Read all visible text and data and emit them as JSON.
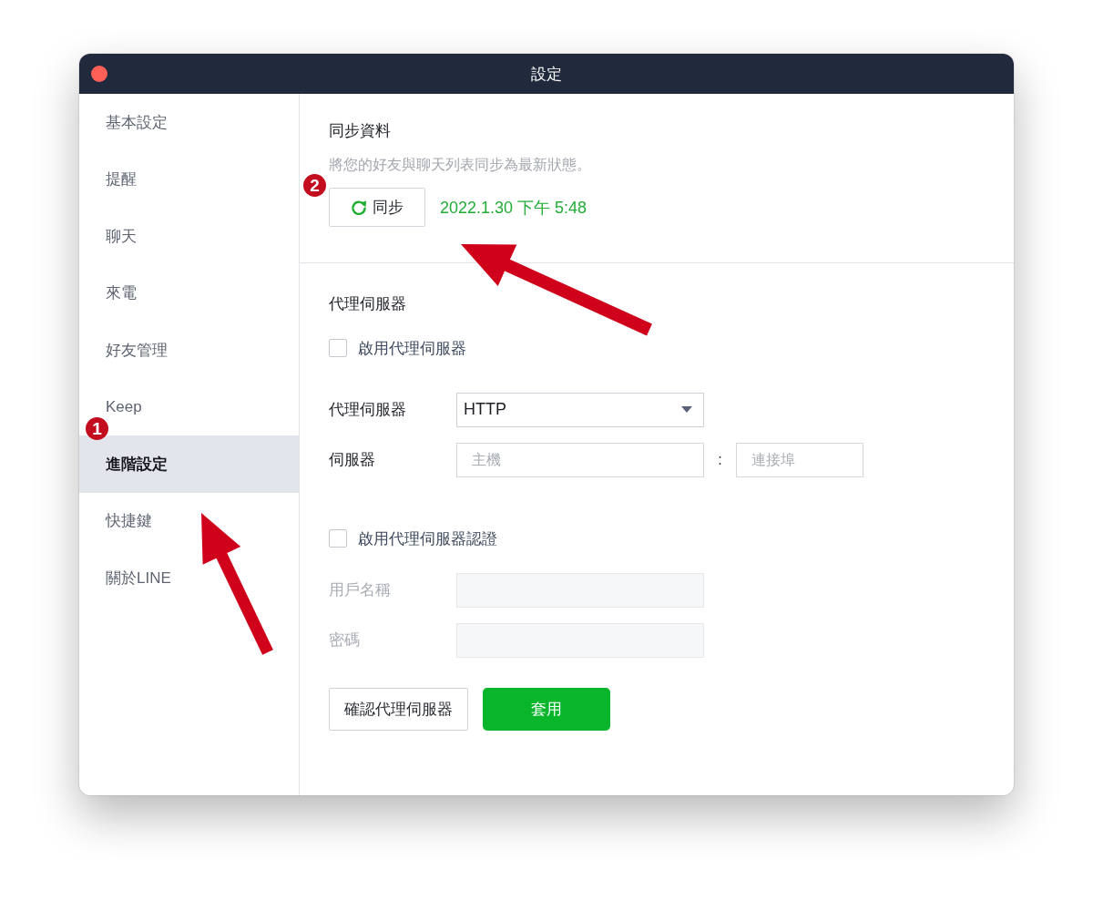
{
  "window": {
    "title": "設定"
  },
  "sidebar": {
    "items": [
      {
        "label": "基本設定",
        "selected": false
      },
      {
        "label": "提醒",
        "selected": false
      },
      {
        "label": "聊天",
        "selected": false
      },
      {
        "label": "來電",
        "selected": false
      },
      {
        "label": "好友管理",
        "selected": false
      },
      {
        "label": "Keep",
        "selected": false
      },
      {
        "label": "進階設定",
        "selected": true
      },
      {
        "label": "快捷鍵",
        "selected": false
      },
      {
        "label": "關於LINE",
        "selected": false
      }
    ]
  },
  "sync": {
    "title": "同步資料",
    "description": "將您的好友與聊天列表同步為最新狀態。",
    "button": "同步",
    "last_synced": "2022.1.30 下午 5:48"
  },
  "proxy": {
    "title": "代理伺服器",
    "enable_checkbox": {
      "label": "啟用代理伺服器",
      "checked": false
    },
    "type_field": {
      "label": "代理伺服器",
      "value": "HTTP"
    },
    "server_field": {
      "label": "伺服器",
      "host_placeholder": "主機",
      "separator": ":",
      "port_placeholder": "連接埠"
    },
    "auth_checkbox": {
      "label": "啟用代理伺服器認證",
      "checked": false
    },
    "credentials": [
      {
        "label": "用戶名稱",
        "disabled": true
      },
      {
        "label": "密碼",
        "disabled": true
      }
    ],
    "buttons": [
      {
        "label": "確認代理伺服器",
        "kind": "secondary"
      },
      {
        "label": "套用",
        "kind": "primary"
      }
    ]
  },
  "annotations": [
    {
      "label": "1"
    },
    {
      "label": "2"
    }
  ]
}
